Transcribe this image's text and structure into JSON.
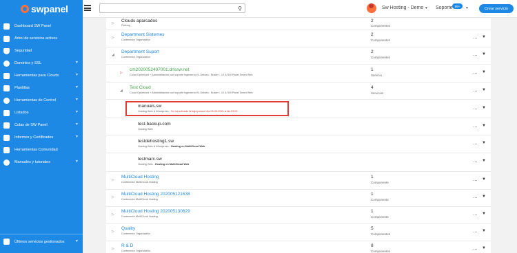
{
  "brand": {
    "name": "swpanel"
  },
  "topbar": {
    "search_placeholder": "",
    "user_name": "Sw Hosting - Demo",
    "support_label": "Soporte",
    "support_badge": "99+",
    "create_button": "Crear servicio"
  },
  "sidebar": {
    "items": [
      {
        "label": "Dashboard SW Panel",
        "icon": "dashboard-icon",
        "chevron": false
      },
      {
        "label": "Árbol de servicios activos",
        "icon": "tree-icon",
        "chevron": false
      },
      {
        "label": "Seguridad",
        "icon": "shield-icon",
        "chevron": false
      },
      {
        "label": "Dominios y SSL",
        "icon": "globe-icon",
        "chevron": true
      },
      {
        "label": "Herramientas para Clouds",
        "icon": "briefcase-icon",
        "chevron": true
      },
      {
        "label": "Plantillas",
        "icon": "file-icon",
        "chevron": true
      },
      {
        "label": "Herramientas de Control",
        "icon": "check-circle-icon",
        "chevron": true
      },
      {
        "label": "Listados",
        "icon": "list-icon",
        "chevron": true
      },
      {
        "label": "Colas de SW Panel",
        "icon": "layers-icon",
        "chevron": true
      },
      {
        "label": "Informes y Certificados",
        "icon": "report-icon",
        "chevron": true
      },
      {
        "label": "Herramientas Comunidad",
        "icon": "community-icon",
        "chevron": false
      },
      {
        "label": "Manuales y tutoriales",
        "icon": "help-icon",
        "chevron": true
      }
    ],
    "bottom_item": {
      "label": "Últimos servicios gestionados",
      "icon": "history-icon"
    }
  },
  "tree": {
    "rows": [
      {
        "toggle": "▷",
        "title": "Clouds aparcados",
        "sub": "Parking",
        "count": "2",
        "count_label": "Componentes",
        "actions": false
      },
      {
        "toggle": "▷",
        "title": "Department Sistemes",
        "sub": "Contenedor Organizativo",
        "count": "2",
        "count_label": "Componentes",
        "actions": true
      },
      {
        "toggle": "◢",
        "title": "Department Suport",
        "sub": "Contenedor Organizativo",
        "count": "2",
        "count_label": "Componentes",
        "actions": true
      },
      {
        "toggle": "▷",
        "title": "cm2020052407001.dnssw.net",
        "sub": "Cloud Optimized + Administración con soporte ingeniería HL Debian - Buster ↓ 10 & SW Panel Smart Web",
        "count": "1",
        "count_label": "Servicio",
        "actions": true
      },
      {
        "toggle": "◢",
        "title": "Test Cloud",
        "sub": "Cloud Optimized + Administración con soporte ingeniería HL Debian - Buster ↓ 10 & SW Panel Smart Web",
        "count": "4",
        "count_label": "Servicios",
        "actions": true
      },
      {
        "toggle": "",
        "title": "manuals.sw",
        "sub": "Hosting Web & Wordpress -",
        "warning": "Se ha activado la baja para el día 09-09-2021 a las 09:09",
        "count": "",
        "count_label": "",
        "actions": true
      },
      {
        "toggle": "",
        "title": "test-backup.com",
        "sub": "Hosting Web",
        "count": "",
        "count_label": "",
        "actions": true
      },
      {
        "toggle": "",
        "title": "testdehosting1.sw",
        "sub": "Hosting Web & Wordpress -",
        "bold": "Hosting en MultiCloud Web",
        "count": "",
        "count_label": "",
        "actions": true
      },
      {
        "toggle": "",
        "title": "testmarc.sw",
        "sub": "Hosting Web -",
        "bold": "Hosting en MultiCloud Web",
        "count": "",
        "count_label": "",
        "actions": true
      },
      {
        "toggle": "▷",
        "title": "MultiCloud Hosting",
        "sub": "Contenedor MultiCloud Hosting",
        "count": "1",
        "count_label": "Componente",
        "actions": true
      },
      {
        "toggle": "▷",
        "title": "MultiCloud Hosting 202005121638",
        "sub": "Contenedor MultiCloud Hosting",
        "count": "1",
        "count_label": "Componente",
        "actions": true
      },
      {
        "toggle": "▷",
        "title": "MultiCloud Hosting 202005130629",
        "sub": "Contenedor MultiCloud Hosting",
        "count": "1",
        "count_label": "Componente",
        "actions": true
      },
      {
        "toggle": "▷",
        "title": "Quality",
        "sub": "Contenedor Organizativo",
        "count": "5",
        "count_label": "Componentes",
        "actions": true
      },
      {
        "toggle": "▷",
        "title": "R & D",
        "sub": "Contenedor Organizativo",
        "count": "8",
        "count_label": "Componentes",
        "actions": true
      }
    ],
    "actions_label": "...",
    "caret_label": "▼"
  },
  "colors": {
    "sidebar": "#1e88e5",
    "accent": "#1e88e5",
    "brand_logo": "#ff6f3c",
    "highlight": "#e53935",
    "green": "#43a047"
  }
}
